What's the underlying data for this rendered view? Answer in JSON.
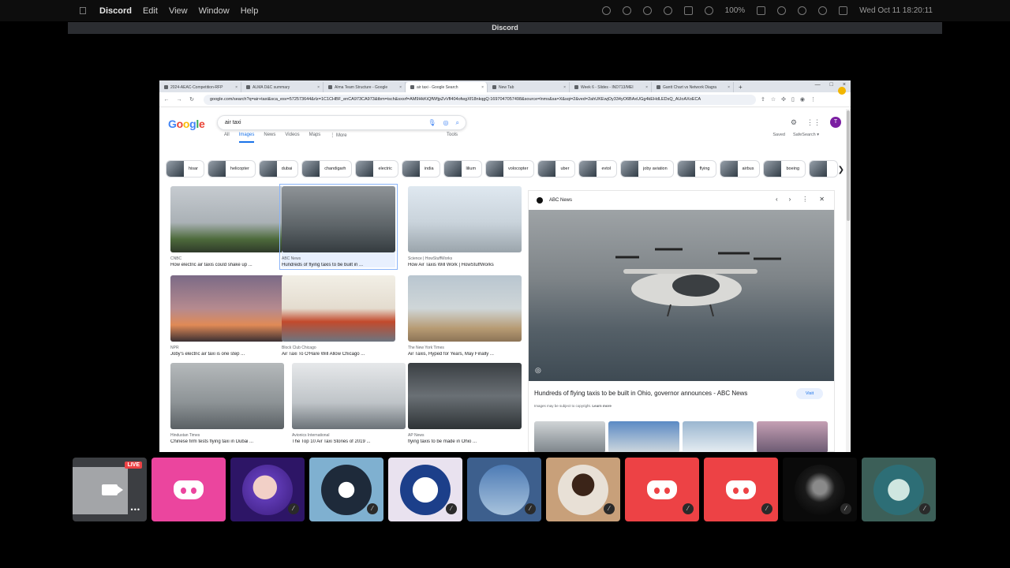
{
  "menubar": {
    "app": "Discord",
    "items": [
      "Edit",
      "View",
      "Window",
      "Help"
    ],
    "battery": "100%",
    "datetime": "Wed Oct 11  18:20:11"
  },
  "window": {
    "title": "Discord"
  },
  "browser": {
    "tabs": [
      {
        "label": "2024-AEAC-Competition-RFP"
      },
      {
        "label": "ALMA D&C summary"
      },
      {
        "label": "Alma Team Structure - Google"
      },
      {
        "label": "air taxi - Google Search",
        "active": true
      },
      {
        "label": "New Tab"
      },
      {
        "label": "Week 6 - Slides - IND713/MEI"
      },
      {
        "label": "Gantt Chart vs Network Diagra"
      }
    ],
    "url": "google.com/search?q=air+taxi&sca_esv=572573644&rlz=1C1CHBF_enCA973CA973&tbm=isch&sxsrf=AM9HkKiQfWfjpZvVfl404ofwgXf18nkqgQ:1697047057498&source=lnms&sa=X&sqi=2&ved=2ahUKEwjOy334yO6BAxUGg4kEHdLEDsQ_AUoAXoECA"
  },
  "google": {
    "logo": [
      "G",
      "o",
      "o",
      "g",
      "l",
      "e"
    ],
    "query": "air taxi",
    "avatar": "T",
    "tabs": [
      "All",
      "Images",
      "News",
      "Videos",
      "Maps",
      "⋮ More"
    ],
    "tools": "Tools",
    "saved": "Saved",
    "safesearch": "SafeSearch ▾",
    "chips": [
      "hisar",
      "helicopter",
      "dubai",
      "chandigarh",
      "electric",
      "india",
      "lilium",
      "volocopter",
      "uber",
      "evtol",
      "joby aviation",
      "flying",
      "airbus",
      "boeing",
      ""
    ],
    "results": [
      {
        "source": "CNBC",
        "title": "How electric air taxis could shake up ..."
      },
      {
        "source": "ABC News",
        "title": "Hundreds of flying taxis to be built in ..."
      },
      {
        "source": "Science | HowStuffWorks",
        "title": "How Air Taxis Will Work | HowStuffWorks"
      },
      {
        "source": "NPR",
        "title": "Joby's electric air taxi is one step ..."
      },
      {
        "source": "Block Club Chicago",
        "title": "Air Taxi To O'Hare Will Allow Chicago ..."
      },
      {
        "source": "The New York Times",
        "title": "Air Taxis, Hyped for Years, May Finally ..."
      },
      {
        "source": "Hindustan Times",
        "title": "Chinese firm tests flying taxi in Dubai ..."
      },
      {
        "source": "Avionics International",
        "title": "The Top 10 Air Taxi Stories of 2019 ..."
      },
      {
        "source": "AP News",
        "title": "flying taxis to be made in Ohio ..."
      }
    ],
    "preview": {
      "source": "ABC News",
      "title": "Hundreds of flying taxis to be built in Ohio, governor announces - ABC News",
      "visit": "Visit",
      "copyright": "Images may be subject to copyright.",
      "learn_more": "Learn more"
    }
  },
  "call": {
    "live": "LIVE",
    "tiles": [
      {
        "type": "stream"
      },
      {
        "type": "discord",
        "color": "#eb459e"
      },
      {
        "type": "avatar",
        "bg": "#3a1b7a"
      },
      {
        "type": "avatar",
        "bg": "#7fb0d0"
      },
      {
        "type": "avatar",
        "bg": "#e9e2ef"
      },
      {
        "type": "avatar",
        "bg": "#3d5f8d"
      },
      {
        "type": "avatar",
        "bg": "#c8a07a"
      },
      {
        "type": "discord",
        "color": "#ed4245"
      },
      {
        "type": "discord",
        "color": "#ed4245"
      },
      {
        "type": "avatar",
        "bg": "#0a0a0a"
      },
      {
        "type": "avatar",
        "bg": "#3c5f58"
      }
    ]
  }
}
